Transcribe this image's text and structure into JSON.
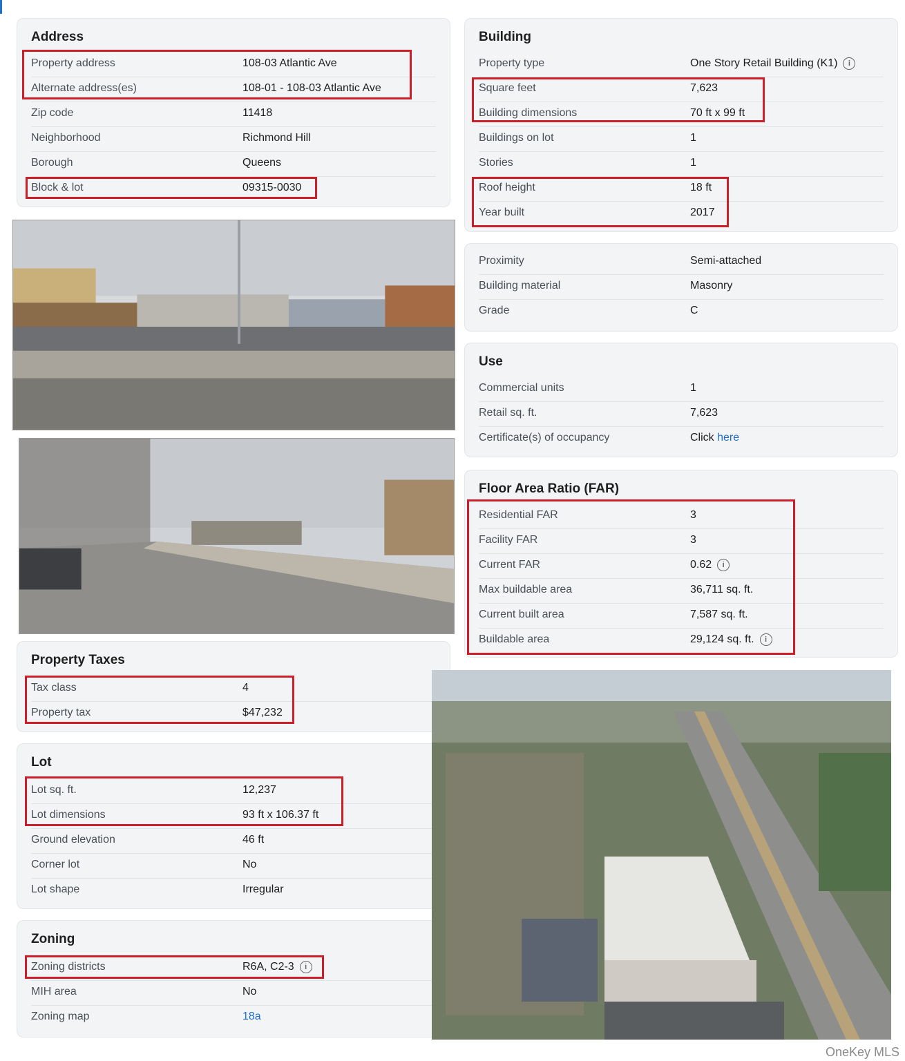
{
  "address": {
    "title": "Address",
    "rows": [
      {
        "label": "Property address",
        "value": "108-03 Atlantic Ave"
      },
      {
        "label": "Alternate address(es)",
        "value": "108-01 - 108-03 Atlantic Ave"
      },
      {
        "label": "Zip code",
        "value": "11418"
      },
      {
        "label": "Neighborhood",
        "value": "Richmond Hill"
      },
      {
        "label": "Borough",
        "value": "Queens"
      },
      {
        "label": "Block & lot",
        "value": "09315-0030"
      }
    ]
  },
  "building": {
    "title": "Building",
    "rows": [
      {
        "label": "Property type",
        "value": "One Story Retail Building (K1)"
      },
      {
        "label": "Square feet",
        "value": "7,623"
      },
      {
        "label": "Building dimensions",
        "value": "70 ft x 99 ft"
      },
      {
        "label": "Buildings on lot",
        "value": "1"
      },
      {
        "label": "Stories",
        "value": "1"
      },
      {
        "label": "Roof height",
        "value": "18 ft"
      },
      {
        "label": "Year built",
        "value": "2017"
      }
    ]
  },
  "construction": {
    "rows": [
      {
        "label": "Proximity",
        "value": "Semi-attached"
      },
      {
        "label": "Building material",
        "value": "Masonry"
      },
      {
        "label": "Grade",
        "value": "C"
      }
    ]
  },
  "use": {
    "title": "Use",
    "rows": [
      {
        "label": "Commercial units",
        "value": "1"
      },
      {
        "label": "Retail sq. ft.",
        "value": "7,623"
      },
      {
        "label": "Certificate(s) of occupancy",
        "value": "Click",
        "link": "here"
      }
    ]
  },
  "far": {
    "title": "Floor Area Ratio (FAR)",
    "rows": [
      {
        "label": "Residential FAR",
        "value": "3"
      },
      {
        "label": "Facility FAR",
        "value": "3"
      },
      {
        "label": "Current FAR",
        "value": "0.62"
      },
      {
        "label": "Max buildable area",
        "value": "36,711 sq. ft."
      },
      {
        "label": "Current built area",
        "value": "7,587 sq. ft."
      },
      {
        "label": "Buildable area",
        "value": "29,124 sq. ft."
      }
    ]
  },
  "taxes": {
    "title": "Property Taxes",
    "rows": [
      {
        "label": "Tax class",
        "value": "4"
      },
      {
        "label": "Property tax",
        "value": "$47,232"
      }
    ]
  },
  "lot": {
    "title": "Lot",
    "rows": [
      {
        "label": "Lot sq. ft.",
        "value": "12,237"
      },
      {
        "label": "Lot dimensions",
        "value": "93 ft x 106.37 ft"
      },
      {
        "label": "Ground elevation",
        "value": "46 ft"
      },
      {
        "label": "Corner lot",
        "value": "No"
      },
      {
        "label": "Lot shape",
        "value": "Irregular"
      }
    ]
  },
  "zoning": {
    "title": "Zoning",
    "rows": [
      {
        "label": "Zoning districts",
        "value": "R6A, C2-3"
      },
      {
        "label": "MIH area",
        "value": "No"
      },
      {
        "label": "Zoning map",
        "value": "18a"
      }
    ]
  },
  "info_glyph": "i",
  "watermark": "OneKey MLS",
  "colors": {
    "highlight": "#cc1f2a",
    "link": "#1f6fd1",
    "card": "#f3f4f6"
  }
}
